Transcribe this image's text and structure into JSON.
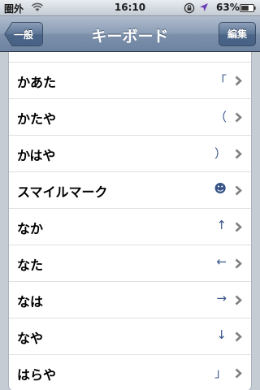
{
  "status_bar": {
    "carrier": "圏外",
    "time": "16:10",
    "battery_percent": "63%",
    "icons": [
      "wifi-icon",
      "orientation-lock-icon",
      "location-icon",
      "battery-icon"
    ]
  },
  "nav_bar": {
    "back_label": "一般",
    "title": "キーボード",
    "edit_label": "編集"
  },
  "colors": {
    "nav_bar": "#6d83a1",
    "background": "#c5ccd4",
    "detail_text": "#385487",
    "chevron": "#7f7f7f"
  },
  "rows": [
    {
      "label": "かあた",
      "value": "「"
    },
    {
      "label": "かたや",
      "value": "（"
    },
    {
      "label": "かはや",
      "value": "）"
    },
    {
      "label": "スマイルマーク",
      "value": "☻"
    },
    {
      "label": "なか",
      "value": "↑"
    },
    {
      "label": "なた",
      "value": "←"
    },
    {
      "label": "なは",
      "value": "→"
    },
    {
      "label": "なや",
      "value": "↓"
    },
    {
      "label": "はらや",
      "value": "」"
    }
  ]
}
